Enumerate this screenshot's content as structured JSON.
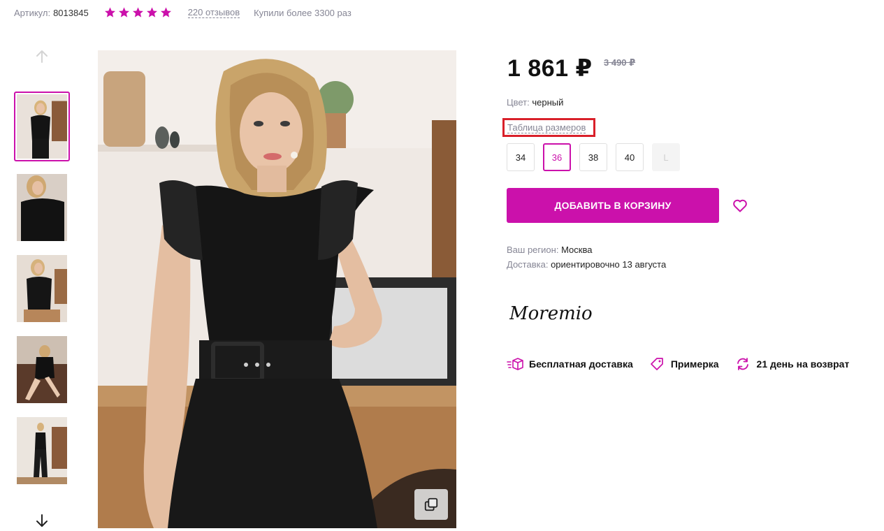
{
  "meta": {
    "sku_label": "Артикул:",
    "sku_value": "8013845",
    "rating": 5,
    "reviews": "220 отзывов",
    "bought": "Купили более 3300 раз"
  },
  "gallery": {
    "thumbnails_count": 5,
    "active_index": 0,
    "up_icon": "arrow-up-icon",
    "down_icon": "arrow-down-icon",
    "zoom_icon": "copy-expand-icon"
  },
  "product": {
    "price": "1 861 ₽",
    "old_price": "3 490 ₽",
    "color_label": "Цвет:",
    "color_value": "черный",
    "size_table": "Таблица размеров",
    "sizes": [
      {
        "label": "34",
        "state": "available"
      },
      {
        "label": "36",
        "state": "selected"
      },
      {
        "label": "38",
        "state": "available"
      },
      {
        "label": "40",
        "state": "available"
      },
      {
        "label": "L",
        "state": "disabled"
      }
    ],
    "add_to_cart": "ДОБАВИТЬ В КОРЗИНУ",
    "favorite_icon": "heart-icon",
    "region_label": "Ваш регион:",
    "region_value": "Москва",
    "delivery_label": "Доставка:",
    "delivery_value": "ориентировочно 13 августа",
    "brand": "Moremio"
  },
  "benefits": [
    {
      "icon": "delivery-box-icon",
      "label": "Бесплатная доставка"
    },
    {
      "icon": "tag-icon",
      "label": "Примерка"
    },
    {
      "icon": "refresh-icon",
      "label": "21 день на возврат"
    }
  ],
  "colors": {
    "accent": "#cb11ab",
    "highlight_box": "#d9202a",
    "muted_text": "#868695"
  }
}
